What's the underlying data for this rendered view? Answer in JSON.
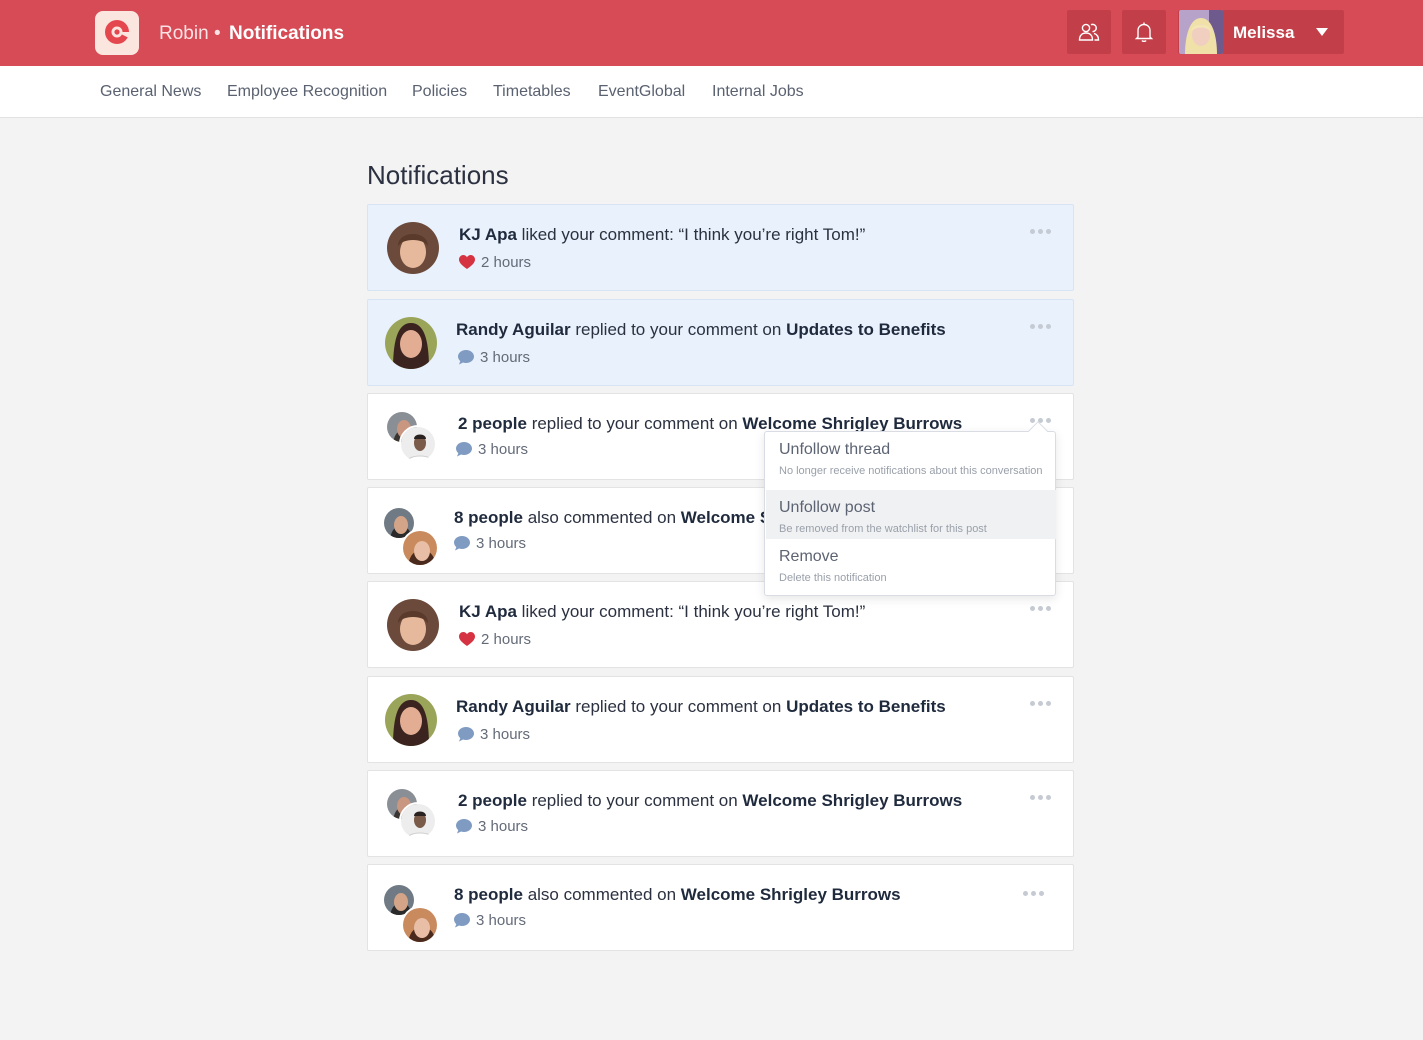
{
  "header": {
    "brand": "Robin",
    "separator": "•",
    "page": "Notifications",
    "user_name": "Melissa",
    "icons": [
      "logo-icon",
      "people-icon",
      "bell-icon",
      "caret-down-icon"
    ],
    "accent_color": "#d64b56"
  },
  "subnav": {
    "items": [
      "General News",
      "Employee Recognition",
      "Policies",
      "Timetables",
      "EventGlobal",
      "Internal Jobs"
    ]
  },
  "main": {
    "title": "Notifications",
    "notifications": [
      {
        "actor": "KJ Apa",
        "action": " liked your comment: “I think you’re right Tom!”",
        "target": "",
        "time": "2 hours",
        "kind": "like",
        "unread": true
      },
      {
        "actor": "Randy Aguilar",
        "action": " replied to your comment on ",
        "target": "Updates to Benefits",
        "time": "3 hours",
        "kind": "comment",
        "unread": true
      },
      {
        "actor": "2 people",
        "action": " replied to your comment on ",
        "target": "Welcome Shrigley Burrows",
        "time": "3 hours",
        "kind": "comment",
        "unread": false
      },
      {
        "actor": "8 people",
        "action": " also commented on ",
        "target": "Welcome Shrigley Burrows",
        "time": "3 hours",
        "kind": "comment",
        "unread": false
      },
      {
        "actor": "KJ Apa",
        "action": " liked your comment: “I think you’re right Tom!”",
        "target": "",
        "time": "2 hours",
        "kind": "like",
        "unread": false
      },
      {
        "actor": "Randy Aguilar",
        "action": " replied to your comment on ",
        "target": "Updates to Benefits",
        "time": "3 hours",
        "kind": "comment",
        "unread": false
      },
      {
        "actor": "2 people",
        "action": " replied to your comment on ",
        "target": "Welcome Shrigley Burrows",
        "time": "3 hours",
        "kind": "comment",
        "unread": false
      },
      {
        "actor": "8 people",
        "action": " also commented on ",
        "target": "Welcome Shrigley Burrows",
        "time": "3 hours",
        "kind": "comment",
        "unread": false
      }
    ]
  },
  "dropdown": {
    "items": [
      {
        "label": "Unfollow thread",
        "sub": "No longer receive notifications about this conversation"
      },
      {
        "label": "Unfollow post",
        "sub": "Be removed from the watchlist for this post"
      },
      {
        "label": "Remove",
        "sub": "Delete this notification"
      }
    ]
  },
  "colors": {
    "like_heart": "#d63342",
    "comment_bubble": "#7f9bc2",
    "unread_bg": "#e8f1fc"
  }
}
